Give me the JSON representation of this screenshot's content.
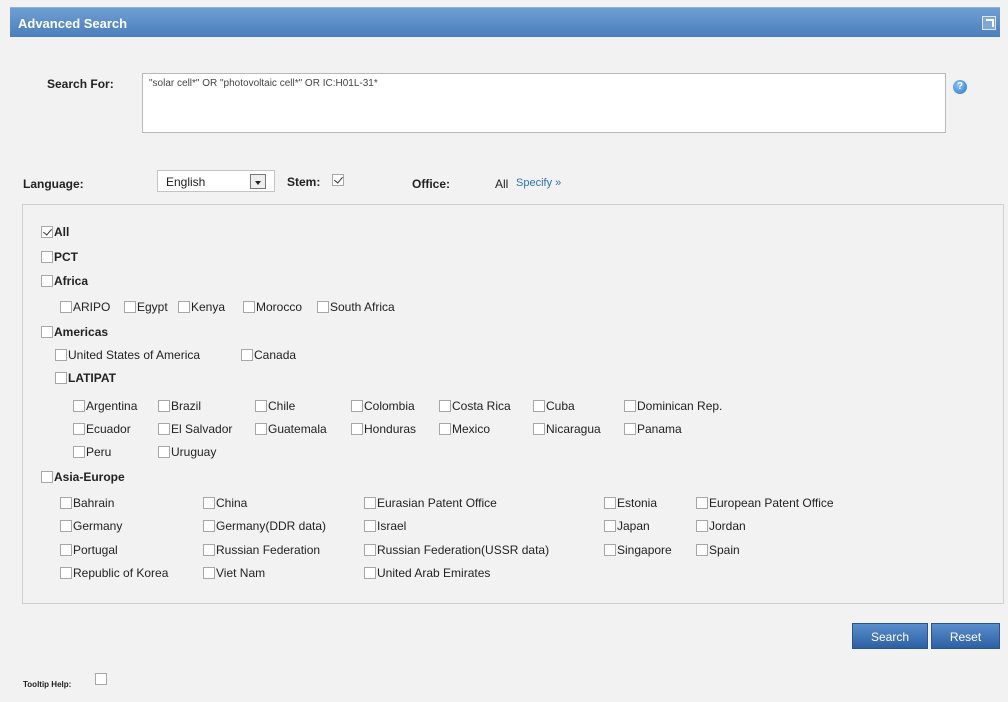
{
  "title": "Advanced Search",
  "search": {
    "label": "Search For:",
    "value": "\"solar cell*\" OR \"photovoltaic cell*\" OR IC:H01L-31*"
  },
  "language": {
    "label": "Language:",
    "selected": "English"
  },
  "stem": {
    "label": "Stem:",
    "checked": true
  },
  "office": {
    "label": "Office:",
    "value": "All",
    "specify": "Specify »"
  },
  "offices": {
    "all": "All",
    "pct": "PCT",
    "africa": {
      "label": "Africa",
      "items": [
        "ARIPO",
        "Egypt",
        "Kenya",
        "Morocco",
        "South Africa"
      ]
    },
    "americas": {
      "label": "Americas",
      "items": [
        "United States of America",
        "Canada"
      ],
      "latipat": {
        "label": "LATIPAT",
        "items": [
          "Argentina",
          "Brazil",
          "Chile",
          "Colombia",
          "Costa Rica",
          "Cuba",
          "Dominican Rep.",
          "Ecuador",
          "El Salvador",
          "Guatemala",
          "Honduras",
          "Mexico",
          "Nicaragua",
          "Panama",
          "Peru",
          "Uruguay"
        ]
      }
    },
    "asia_europe": {
      "label": "Asia-Europe",
      "items": [
        "Bahrain",
        "China",
        "Eurasian Patent Office",
        "Estonia",
        "European Patent Office",
        "Germany",
        "Germany(DDR data)",
        "Israel",
        "Japan",
        "Jordan",
        "Portugal",
        "Russian Federation",
        "Russian Federation(USSR data)",
        "Singapore",
        "Spain",
        "Republic of Korea",
        "Viet Nam",
        "United Arab Emirates"
      ]
    }
  },
  "buttons": {
    "search": "Search",
    "reset": "Reset"
  },
  "tooltip": {
    "label": "Tooltip Help:"
  }
}
